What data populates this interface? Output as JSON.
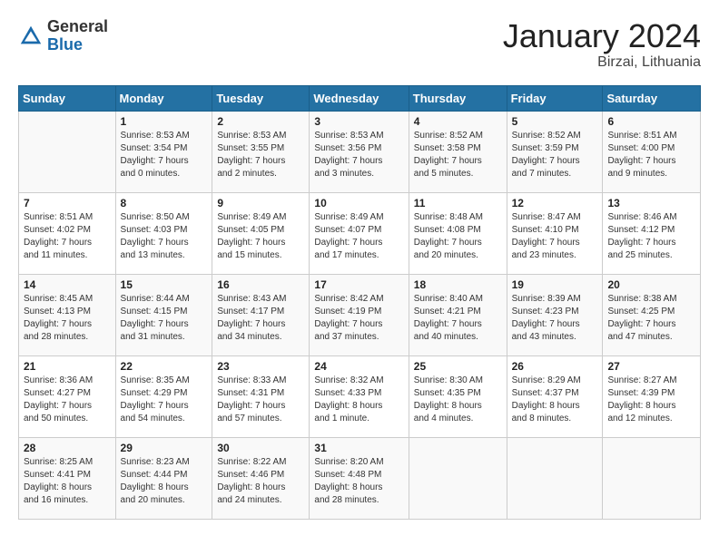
{
  "header": {
    "logo_general": "General",
    "logo_blue": "Blue",
    "title": "January 2024",
    "location": "Birzai, Lithuania"
  },
  "calendar": {
    "days_of_week": [
      "Sunday",
      "Monday",
      "Tuesday",
      "Wednesday",
      "Thursday",
      "Friday",
      "Saturday"
    ],
    "weeks": [
      [
        {
          "day": "",
          "info": ""
        },
        {
          "day": "1",
          "info": "Sunrise: 8:53 AM\nSunset: 3:54 PM\nDaylight: 7 hours\nand 0 minutes."
        },
        {
          "day": "2",
          "info": "Sunrise: 8:53 AM\nSunset: 3:55 PM\nDaylight: 7 hours\nand 2 minutes."
        },
        {
          "day": "3",
          "info": "Sunrise: 8:53 AM\nSunset: 3:56 PM\nDaylight: 7 hours\nand 3 minutes."
        },
        {
          "day": "4",
          "info": "Sunrise: 8:52 AM\nSunset: 3:58 PM\nDaylight: 7 hours\nand 5 minutes."
        },
        {
          "day": "5",
          "info": "Sunrise: 8:52 AM\nSunset: 3:59 PM\nDaylight: 7 hours\nand 7 minutes."
        },
        {
          "day": "6",
          "info": "Sunrise: 8:51 AM\nSunset: 4:00 PM\nDaylight: 7 hours\nand 9 minutes."
        }
      ],
      [
        {
          "day": "7",
          "info": "Sunrise: 8:51 AM\nSunset: 4:02 PM\nDaylight: 7 hours\nand 11 minutes."
        },
        {
          "day": "8",
          "info": "Sunrise: 8:50 AM\nSunset: 4:03 PM\nDaylight: 7 hours\nand 13 minutes."
        },
        {
          "day": "9",
          "info": "Sunrise: 8:49 AM\nSunset: 4:05 PM\nDaylight: 7 hours\nand 15 minutes."
        },
        {
          "day": "10",
          "info": "Sunrise: 8:49 AM\nSunset: 4:07 PM\nDaylight: 7 hours\nand 17 minutes."
        },
        {
          "day": "11",
          "info": "Sunrise: 8:48 AM\nSunset: 4:08 PM\nDaylight: 7 hours\nand 20 minutes."
        },
        {
          "day": "12",
          "info": "Sunrise: 8:47 AM\nSunset: 4:10 PM\nDaylight: 7 hours\nand 23 minutes."
        },
        {
          "day": "13",
          "info": "Sunrise: 8:46 AM\nSunset: 4:12 PM\nDaylight: 7 hours\nand 25 minutes."
        }
      ],
      [
        {
          "day": "14",
          "info": "Sunrise: 8:45 AM\nSunset: 4:13 PM\nDaylight: 7 hours\nand 28 minutes."
        },
        {
          "day": "15",
          "info": "Sunrise: 8:44 AM\nSunset: 4:15 PM\nDaylight: 7 hours\nand 31 minutes."
        },
        {
          "day": "16",
          "info": "Sunrise: 8:43 AM\nSunset: 4:17 PM\nDaylight: 7 hours\nand 34 minutes."
        },
        {
          "day": "17",
          "info": "Sunrise: 8:42 AM\nSunset: 4:19 PM\nDaylight: 7 hours\nand 37 minutes."
        },
        {
          "day": "18",
          "info": "Sunrise: 8:40 AM\nSunset: 4:21 PM\nDaylight: 7 hours\nand 40 minutes."
        },
        {
          "day": "19",
          "info": "Sunrise: 8:39 AM\nSunset: 4:23 PM\nDaylight: 7 hours\nand 43 minutes."
        },
        {
          "day": "20",
          "info": "Sunrise: 8:38 AM\nSunset: 4:25 PM\nDaylight: 7 hours\nand 47 minutes."
        }
      ],
      [
        {
          "day": "21",
          "info": "Sunrise: 8:36 AM\nSunset: 4:27 PM\nDaylight: 7 hours\nand 50 minutes."
        },
        {
          "day": "22",
          "info": "Sunrise: 8:35 AM\nSunset: 4:29 PM\nDaylight: 7 hours\nand 54 minutes."
        },
        {
          "day": "23",
          "info": "Sunrise: 8:33 AM\nSunset: 4:31 PM\nDaylight: 7 hours\nand 57 minutes."
        },
        {
          "day": "24",
          "info": "Sunrise: 8:32 AM\nSunset: 4:33 PM\nDaylight: 8 hours\nand 1 minute."
        },
        {
          "day": "25",
          "info": "Sunrise: 8:30 AM\nSunset: 4:35 PM\nDaylight: 8 hours\nand 4 minutes."
        },
        {
          "day": "26",
          "info": "Sunrise: 8:29 AM\nSunset: 4:37 PM\nDaylight: 8 hours\nand 8 minutes."
        },
        {
          "day": "27",
          "info": "Sunrise: 8:27 AM\nSunset: 4:39 PM\nDaylight: 8 hours\nand 12 minutes."
        }
      ],
      [
        {
          "day": "28",
          "info": "Sunrise: 8:25 AM\nSunset: 4:41 PM\nDaylight: 8 hours\nand 16 minutes."
        },
        {
          "day": "29",
          "info": "Sunrise: 8:23 AM\nSunset: 4:44 PM\nDaylight: 8 hours\nand 20 minutes."
        },
        {
          "day": "30",
          "info": "Sunrise: 8:22 AM\nSunset: 4:46 PM\nDaylight: 8 hours\nand 24 minutes."
        },
        {
          "day": "31",
          "info": "Sunrise: 8:20 AM\nSunset: 4:48 PM\nDaylight: 8 hours\nand 28 minutes."
        },
        {
          "day": "",
          "info": ""
        },
        {
          "day": "",
          "info": ""
        },
        {
          "day": "",
          "info": ""
        }
      ]
    ]
  }
}
